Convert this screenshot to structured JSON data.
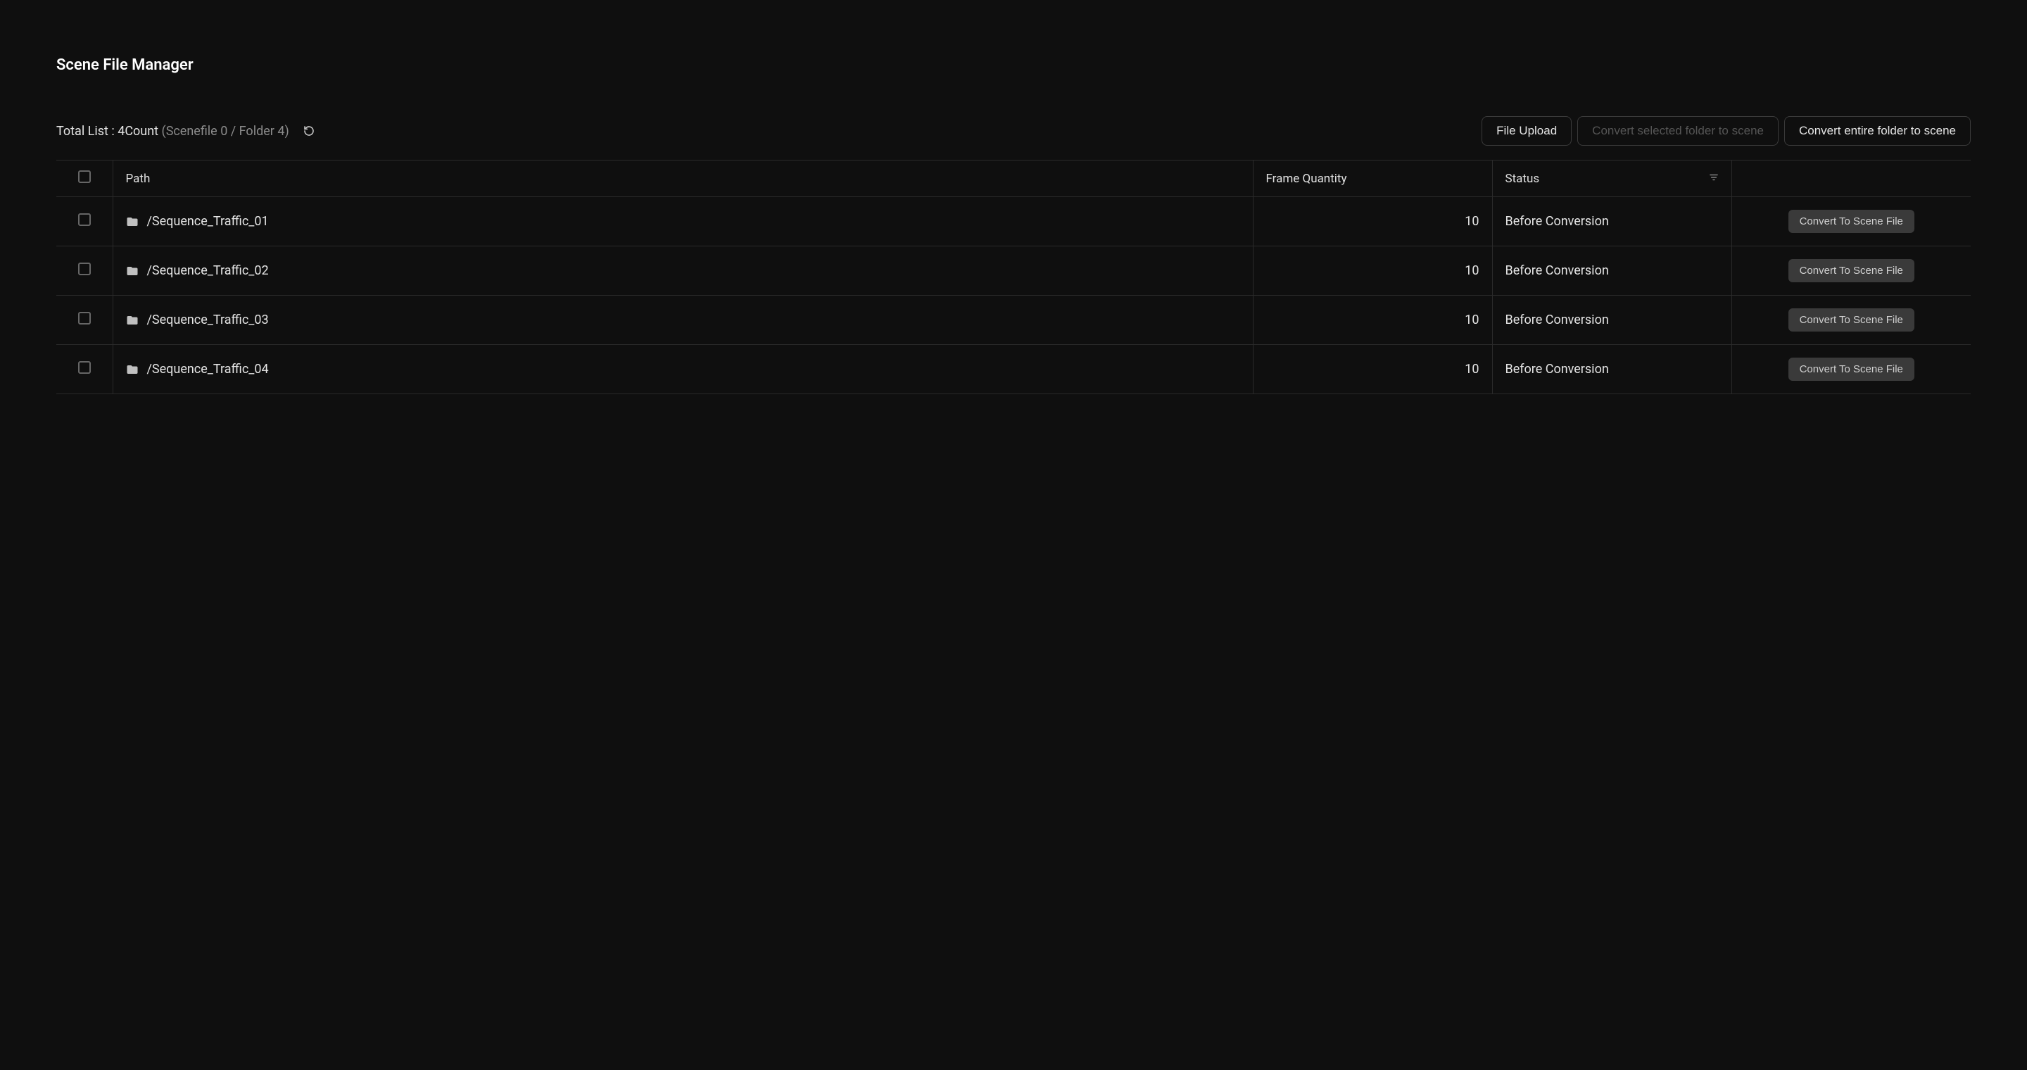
{
  "header": {
    "title": "Scene File Manager"
  },
  "toolbar": {
    "totalListPrefix": "Total List : ",
    "totalCount": "4",
    "countSuffix": "Count",
    "countDetail": "(Scenefile 0 / Folder 4)",
    "buttons": {
      "fileUpload": "File Upload",
      "convertSelected": "Convert selected folder to scene",
      "convertEntire": "Convert entire folder to scene"
    }
  },
  "table": {
    "columns": {
      "path": "Path",
      "frameQuantity": "Frame Quantity",
      "status": "Status"
    },
    "rows": [
      {
        "path": "/Sequence_Traffic_01",
        "frameQuantity": "10",
        "status": "Before Conversion",
        "action": "Convert To Scene File"
      },
      {
        "path": "/Sequence_Traffic_02",
        "frameQuantity": "10",
        "status": "Before Conversion",
        "action": "Convert To Scene File"
      },
      {
        "path": "/Sequence_Traffic_03",
        "frameQuantity": "10",
        "status": "Before Conversion",
        "action": "Convert To Scene File"
      },
      {
        "path": "/Sequence_Traffic_04",
        "frameQuantity": "10",
        "status": "Before Conversion",
        "action": "Convert To Scene File"
      }
    ]
  }
}
